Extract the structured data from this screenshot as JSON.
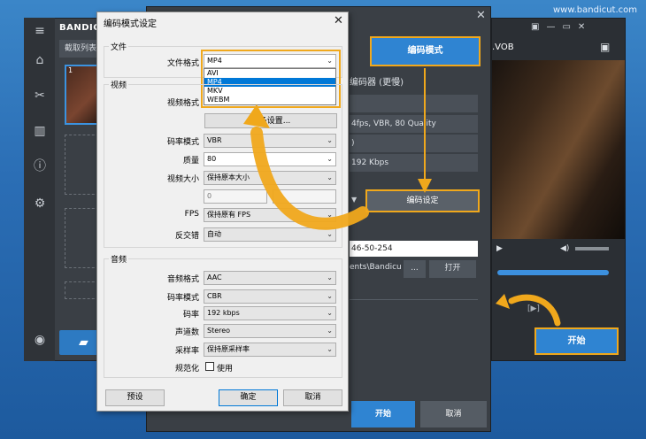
{
  "watermark": "www.bandicut.com",
  "back_window": {
    "logo": "BANDIC",
    "tab": "截取列表",
    "side_icons": [
      "menu-icon",
      "home-icon",
      "cut-icon",
      "join-icon",
      "info-icon",
      "settings-icon",
      "record-icon"
    ],
    "thumb_number": "1"
  },
  "right_window": {
    "title": ".VOB",
    "start_label": "开始",
    "time_text": "[▶]"
  },
  "encoder_window": {
    "mode_button": "编码模式",
    "mode_text": "编码器 (更慢)",
    "rows": [
      "",
      "4fps, VBR, 80 Quality",
      ")",
      "192 Kbps"
    ],
    "settings_button": "编码设定",
    "filename": "46-50-254",
    "path": "ents\\Bandicu",
    "browse_button": "...",
    "open_button": "打开",
    "start_button": "开始",
    "cancel_button": "取消"
  },
  "dialog": {
    "title": "编码模式设定",
    "file_group": "文件",
    "file_format_label": "文件格式",
    "file_format_value": "MP4",
    "file_format_options": [
      "AVI",
      "MP4",
      "MKV",
      "WEBM"
    ],
    "file_format_selected": "MP4",
    "video_group": "视频",
    "video_format_label": "视频格式",
    "more_settings": "更多设置...",
    "rate_mode_label": "码率模式",
    "rate_mode_value": "VBR",
    "quality_label": "质量",
    "quality_value": "80",
    "video_size_label": "视频大小",
    "video_size_value": "保持原本大小",
    "size_w": "0",
    "fps_label": "FPS",
    "fps_value": "保持原有 FPS",
    "deinterlace_label": "反交错",
    "deinterlace_value": "自动",
    "audio_group": "音频",
    "audio_format_label": "音频格式",
    "audio_format_value": "AAC",
    "audio_rate_mode_label": "码率模式",
    "audio_rate_mode_value": "CBR",
    "bitrate_label": "码率",
    "bitrate_value": "192 kbps",
    "channels_label": "声道数",
    "channels_value": "Stereo",
    "samplerate_label": "采样率",
    "samplerate_value": "保持原采样率",
    "normalize_label": "规范化",
    "normalize_check": "使用",
    "preset_button": "预设",
    "ok_button": "确定",
    "cancel_button": "取消"
  },
  "colors": {
    "accent": "#2f84d2",
    "highlight": "#f0a81c",
    "dialog_bg": "#f0f0f0"
  }
}
